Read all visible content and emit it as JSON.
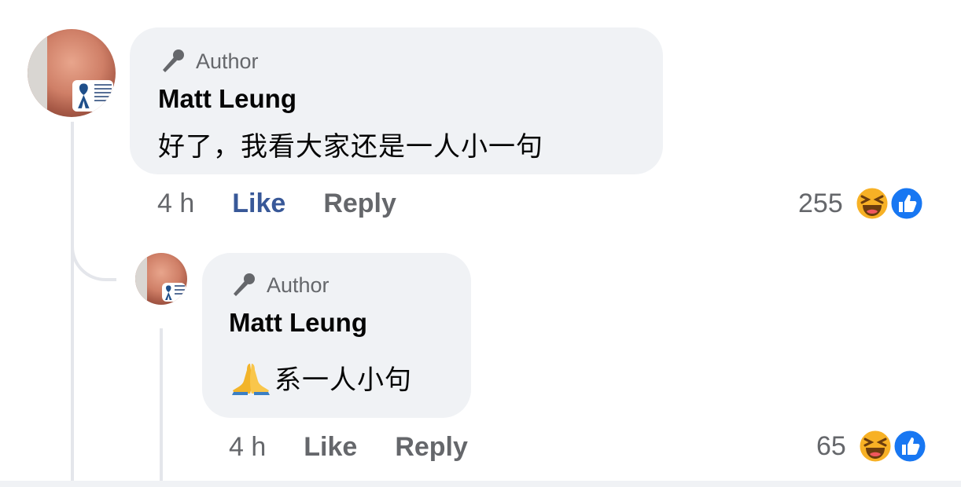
{
  "comments": [
    {
      "author_badge": "Author",
      "name": "Matt Leung",
      "text": "好了，我看大家还是一人小一句",
      "time": "4 h",
      "like_label": "Like",
      "reply_label": "Reply",
      "reaction_count": "255"
    },
    {
      "author_badge": "Author",
      "name": "Matt Leung",
      "text": "系一人小句",
      "emoji": "pray-emoji",
      "time": "4 h",
      "like_label": "Like",
      "reply_label": "Reply",
      "reaction_count": "65"
    }
  ],
  "colors": {
    "like_active": "#385898",
    "bubble": "#f0f2f5",
    "meta": "#65676b",
    "thread_line": "#e4e6eb",
    "haha": "#f7b125",
    "like_reaction": "#1877f2"
  },
  "icons": [
    "microphone-icon",
    "haha-reaction-icon",
    "like-reaction-icon",
    "awareness-ribbon-icon"
  ]
}
